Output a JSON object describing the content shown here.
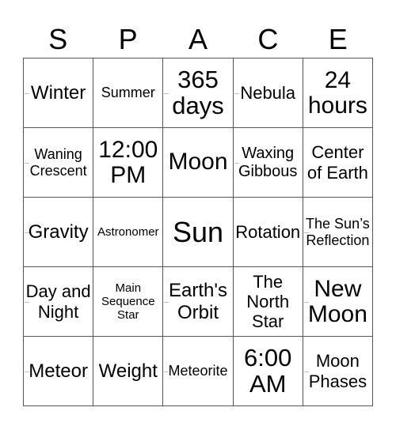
{
  "title_letters": [
    "S",
    "P",
    "A",
    "C",
    "E"
  ],
  "cells": [
    [
      "Winter",
      "Summer",
      "365 days",
      "Nebula",
      "24 hours"
    ],
    [
      "Waning Crescent",
      "12:00 PM",
      "Moon",
      "Waxing Gibbous",
      "Center of Earth"
    ],
    [
      "Gravity",
      "Astronomer",
      "Sun",
      "Rotation",
      "The Sun’s Reflection"
    ],
    [
      "Day and Night",
      "Main Sequence Star",
      "Earth's Orbit",
      "The North Star",
      "New Moon"
    ],
    [
      "Meteor",
      "Weight",
      "Meteorite",
      "6:00 AM",
      "Moon Phases"
    ]
  ]
}
